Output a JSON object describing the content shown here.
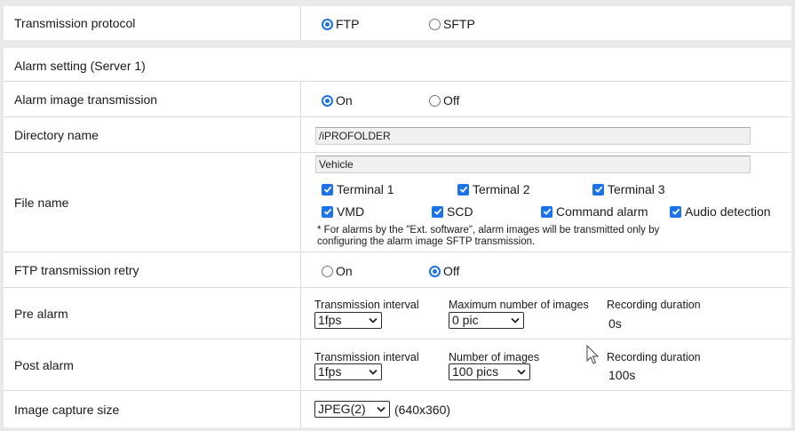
{
  "transmission_protocol": {
    "label": "Transmission protocol",
    "options": [
      {
        "label": "FTP",
        "selected": true
      },
      {
        "label": "SFTP",
        "selected": false
      }
    ]
  },
  "alarm_setting": {
    "title": "Alarm setting (Server 1)",
    "alarm_image_transmission": {
      "label": "Alarm image transmission",
      "options": [
        {
          "label": "On",
          "selected": true
        },
        {
          "label": "Off",
          "selected": false
        }
      ]
    },
    "directory_name": {
      "label": "Directory name",
      "value": "/iPROFOLDER"
    },
    "file_name": {
      "label": "File name",
      "value": "Vehicle",
      "checkboxes": [
        {
          "label": "Terminal 1",
          "checked": true
        },
        {
          "label": "Terminal 2",
          "checked": true
        },
        {
          "label": "Terminal 3",
          "checked": true
        },
        {
          "label": "VMD",
          "checked": true
        },
        {
          "label": "SCD",
          "checked": true
        },
        {
          "label": "Command alarm",
          "checked": true
        },
        {
          "label": "Audio detection",
          "checked": true
        }
      ],
      "note_line1": "* For alarms by the \"Ext. software\", alarm images will be transmitted only by",
      "note_line2": "configuring the alarm image SFTP transmission."
    },
    "ftp_retry": {
      "label": "FTP transmission retry",
      "options": [
        {
          "label": "On",
          "selected": false
        },
        {
          "label": "Off",
          "selected": true
        }
      ]
    },
    "pre_alarm": {
      "label": "Pre alarm",
      "interval_label": "Transmission interval",
      "interval_value": "1fps",
      "images_label": "Maximum number of images",
      "images_value": "0 pic",
      "duration_label": "Recording duration",
      "duration_value": "0s"
    },
    "post_alarm": {
      "label": "Post alarm",
      "interval_label": "Transmission interval",
      "interval_value": "1fps",
      "images_label": "Number of images",
      "images_value": "100 pics",
      "duration_label": "Recording duration",
      "duration_value": "100s"
    },
    "image_capture_size": {
      "label": "Image capture size",
      "value": "JPEG(2)",
      "resolution": "(640x360)"
    }
  },
  "colors": {
    "accent": "#1a73e8",
    "background": "#e9e9e9",
    "panel": "#ffffff"
  },
  "icons": [
    "checkmark-icon",
    "dropdown-arrow-icon",
    "mouse-pointer-icon"
  ]
}
